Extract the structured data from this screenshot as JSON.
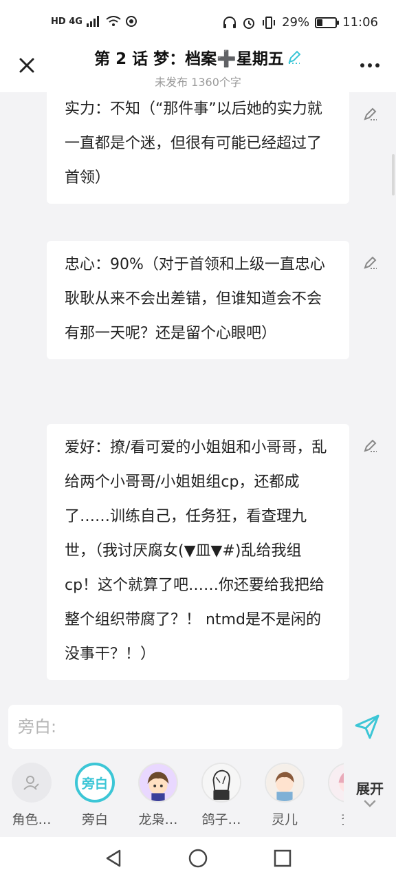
{
  "status_bar": {
    "network": "HD 4G",
    "battery_percent": "29%",
    "battery_level": 0.29,
    "time": "11:06"
  },
  "header": {
    "title": "第 2 话 梦：档案➕星期五",
    "subtitle": "未发布 1360个字"
  },
  "cards": [
    {
      "text": "实力：不知（“那件事”以后她的实力就一直都是个迷，但很有可能已经超过了首领）"
    },
    {
      "text": "忠心：90%（对于首领和上级一直忠心耿耿从来不会出差错，但谁知道会不会有那一天呢？还是留个心眼吧）"
    },
    {
      "text": "爱好：撩/看可爱的小姐姐和小哥哥，乱给两个小哥哥/小姐姐组cp，还都成了……训练自己，任务狂，看查理九世，（我讨厌腐女(▼皿▼#)乱给我组cp！这个就算了吧……你还要给我把给整个组织带腐了？！ ntmd是不是闲的没事干？！）"
    }
  ],
  "input": {
    "placeholder": "旁白:"
  },
  "roles": [
    {
      "label": "角色…",
      "icon": "add-role-icon"
    },
    {
      "label": "旁白",
      "avatar_text": "旁白",
      "active": true
    },
    {
      "label": "龙枭…",
      "icon": "anime-avatar"
    },
    {
      "label": "鸽子…",
      "icon": "sketch-avatar"
    },
    {
      "label": "灵儿",
      "icon": "anime-avatar"
    },
    {
      "label": "查",
      "icon": "anime-avatar"
    }
  ],
  "expand_label": "展开",
  "colors": {
    "accent": "#3cc6d6",
    "card_bg": "#ffffff",
    "page_bg": "#f3f3f5"
  }
}
